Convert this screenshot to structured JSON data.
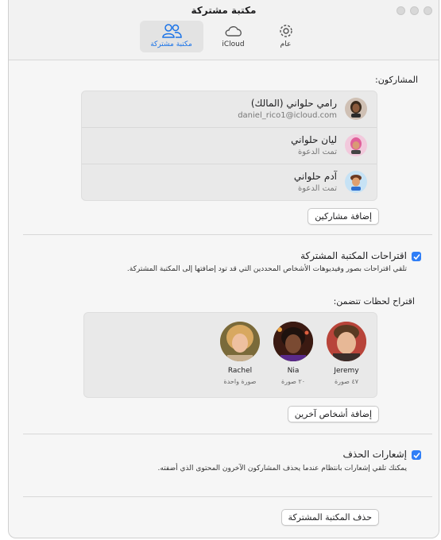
{
  "window": {
    "title": "مكتبة مشتركة"
  },
  "tabs": [
    {
      "label": "عام",
      "icon": "gear-icon"
    },
    {
      "label": "iCloud",
      "icon": "cloud-icon"
    },
    {
      "label": "مكتبة مشتركة",
      "icon": "people-icon",
      "selected": true
    }
  ],
  "participants": {
    "heading": "المشاركون:",
    "list": [
      {
        "name": "رامي حلواني (المالك)",
        "subtitle": "daniel_rico1@icloud.com",
        "avatar": "memoji-owner"
      },
      {
        "name": "ليان حلواني",
        "subtitle": "تمت الدعوة",
        "avatar": "memoji-lian"
      },
      {
        "name": "آدم حلواني",
        "subtitle": "تمت الدعوة",
        "avatar": "memoji-adam"
      }
    ],
    "add_button": "إضافة مشاركين"
  },
  "suggestions": {
    "checkbox_label": "اقتراحات المكتبة المشتركة",
    "checked": true,
    "description": "تلقي اقتراحات بصور وفيديوهات الأشخاص المحددين التي قد تود إضافتها إلى المكتبة المشتركة.",
    "moments_heading": "اقتراح لحظات تتضمن:",
    "people": [
      {
        "name": "Jeremy",
        "count": "٤٧ صورة"
      },
      {
        "name": "Nia",
        "count": "٢٠ صورة"
      },
      {
        "name": "Rachel",
        "count": "صورة واحدة"
      }
    ],
    "add_people_button": "إضافة أشخاص آخرين"
  },
  "deletion": {
    "checkbox_label": "إشعارات الحذف",
    "checked": true,
    "description": "يمكنك تلقي إشعارات بانتظام عندما يحذف المشاركون الآخرون المحتوى الذي أضفته."
  },
  "delete_button": "حذف المكتبة المشتركة",
  "colors": {
    "accent": "#2f7ef7",
    "selected_tab_text": "#1a73e8"
  }
}
